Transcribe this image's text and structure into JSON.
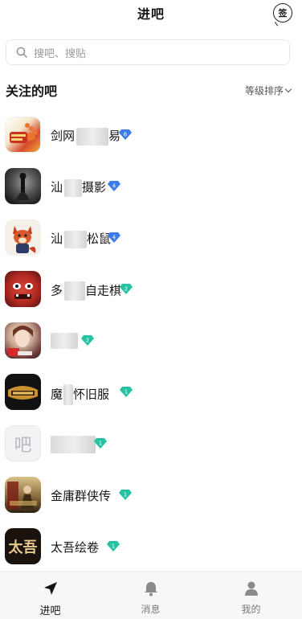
{
  "header": {
    "title": "进吧",
    "sign_label": "签"
  },
  "search": {
    "placeholder": "搜吧、搜贴",
    "icon": "search-icon"
  },
  "section": {
    "title": "关注的吧",
    "sort_label": "等级排序"
  },
  "forums": [
    {
      "name_prefix": "剑网",
      "name_suffix": "易",
      "level": "6",
      "badge_color": "#3b7bea"
    },
    {
      "name_prefix": "汕",
      "name_suffix": "摄影",
      "level": "4",
      "badge_color": "#3b7bea"
    },
    {
      "name_prefix": "汕",
      "name_suffix": "松鼠",
      "level": "4",
      "badge_color": "#3b7bea"
    },
    {
      "name_prefix": "多",
      "name_suffix": "自走棋",
      "level": "2",
      "badge_color": "#22c2a3"
    },
    {
      "name_prefix": "",
      "name_suffix": "",
      "level": "2",
      "badge_color": "#22c2a3"
    },
    {
      "name_prefix": "魔",
      "name_suffix": "怀旧服",
      "level": "1",
      "badge_color": "#22c2a3"
    },
    {
      "name_prefix": "",
      "name_suffix": "",
      "level": "1",
      "badge_color": "#22c2a3"
    },
    {
      "name_prefix": "金庸群侠传",
      "name_suffix": "",
      "level": "1",
      "badge_color": "#22c2a3"
    },
    {
      "name_prefix": "太吾绘卷",
      "name_suffix": "",
      "level": "1",
      "badge_color": "#22c2a3"
    }
  ],
  "default_avatar_glyph": "吧",
  "taiwu_avatar_glyph": "太吾",
  "tabs": [
    {
      "label": "进吧",
      "icon": "send-icon",
      "active": true
    },
    {
      "label": "消息",
      "icon": "bell-icon",
      "active": false
    },
    {
      "label": "我的",
      "icon": "user-icon",
      "active": false
    }
  ]
}
